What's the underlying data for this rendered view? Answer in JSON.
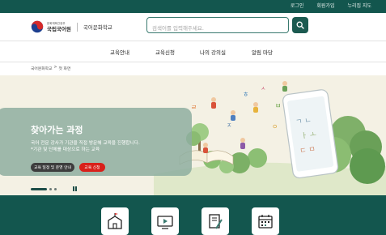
{
  "top_links": [
    "로그인",
    "회원가입",
    "누리집 지도"
  ],
  "logo": {
    "ministry": "문화체육관광부",
    "institute": "국립국어원",
    "school": "국어문화학교"
  },
  "search": {
    "placeholder": "검색어를 입력해주세요."
  },
  "nav": [
    "교육안내",
    "교육신청",
    "나의 강의실",
    "알림 마당"
  ],
  "breadcrumb": {
    "home": "국어문화학교",
    "separator": ">",
    "current": "첫 화면"
  },
  "hero": {
    "title": "찾아가는 과정",
    "desc_line1": "국어 전문 강사가 기관을 직접 방문해 교육을 진행합니다.",
    "desc_line2": "*기관 및 단체를 대상으로 하는 교육",
    "btn_guide": "교육 일정 및 운영 안내",
    "btn_apply": "교육 신청",
    "slides_total": 3,
    "slide_current": 1
  },
  "quick_links": [
    "school-building-icon",
    "video-play-icon",
    "certificate-icon",
    "calendar-icon"
  ],
  "colors": {
    "brand_dark_green": "#13564e",
    "search_button": "#1b5a50",
    "apply_red": "#d8201a",
    "panel_green": "#8eaea0",
    "hero_bg": "#f4f1e4"
  }
}
